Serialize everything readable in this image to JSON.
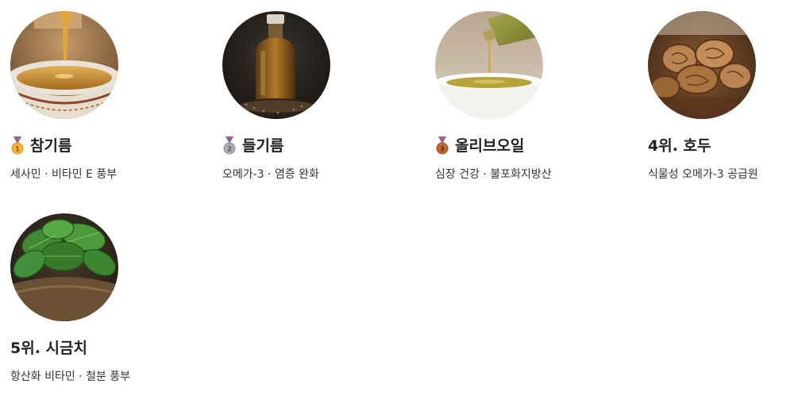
{
  "items": [
    {
      "title": "참기름",
      "desc": "세사민 · 비타민 E 풍부",
      "medal": "gold-medal-icon",
      "image": "sesame-oil-pouring-photo"
    },
    {
      "title": "들기름",
      "desc": "오메가-3 · 염증 완화",
      "medal": "silver-medal-icon",
      "image": "perilla-oil-bottle-photo"
    },
    {
      "title": "올리브오일",
      "desc": "심장 건강 · 불포화지방산",
      "medal": "bronze-medal-icon",
      "image": "olive-oil-bowl-photo"
    },
    {
      "title": "4위. 호두",
      "desc": "식물성 오메가-3 공급원",
      "medal": "",
      "image": "walnuts-photo"
    },
    {
      "title": "5위. 시금치",
      "desc": "항산화 비타민 · 철분 풍부",
      "medal": "",
      "image": "spinach-photo"
    }
  ],
  "colors": {
    "gold": "#f2b33d",
    "silver": "#a8acb3",
    "bronze": "#c4642c",
    "ribbon_blue": "#4a6fd0",
    "ribbon_red": "#d9534f"
  }
}
